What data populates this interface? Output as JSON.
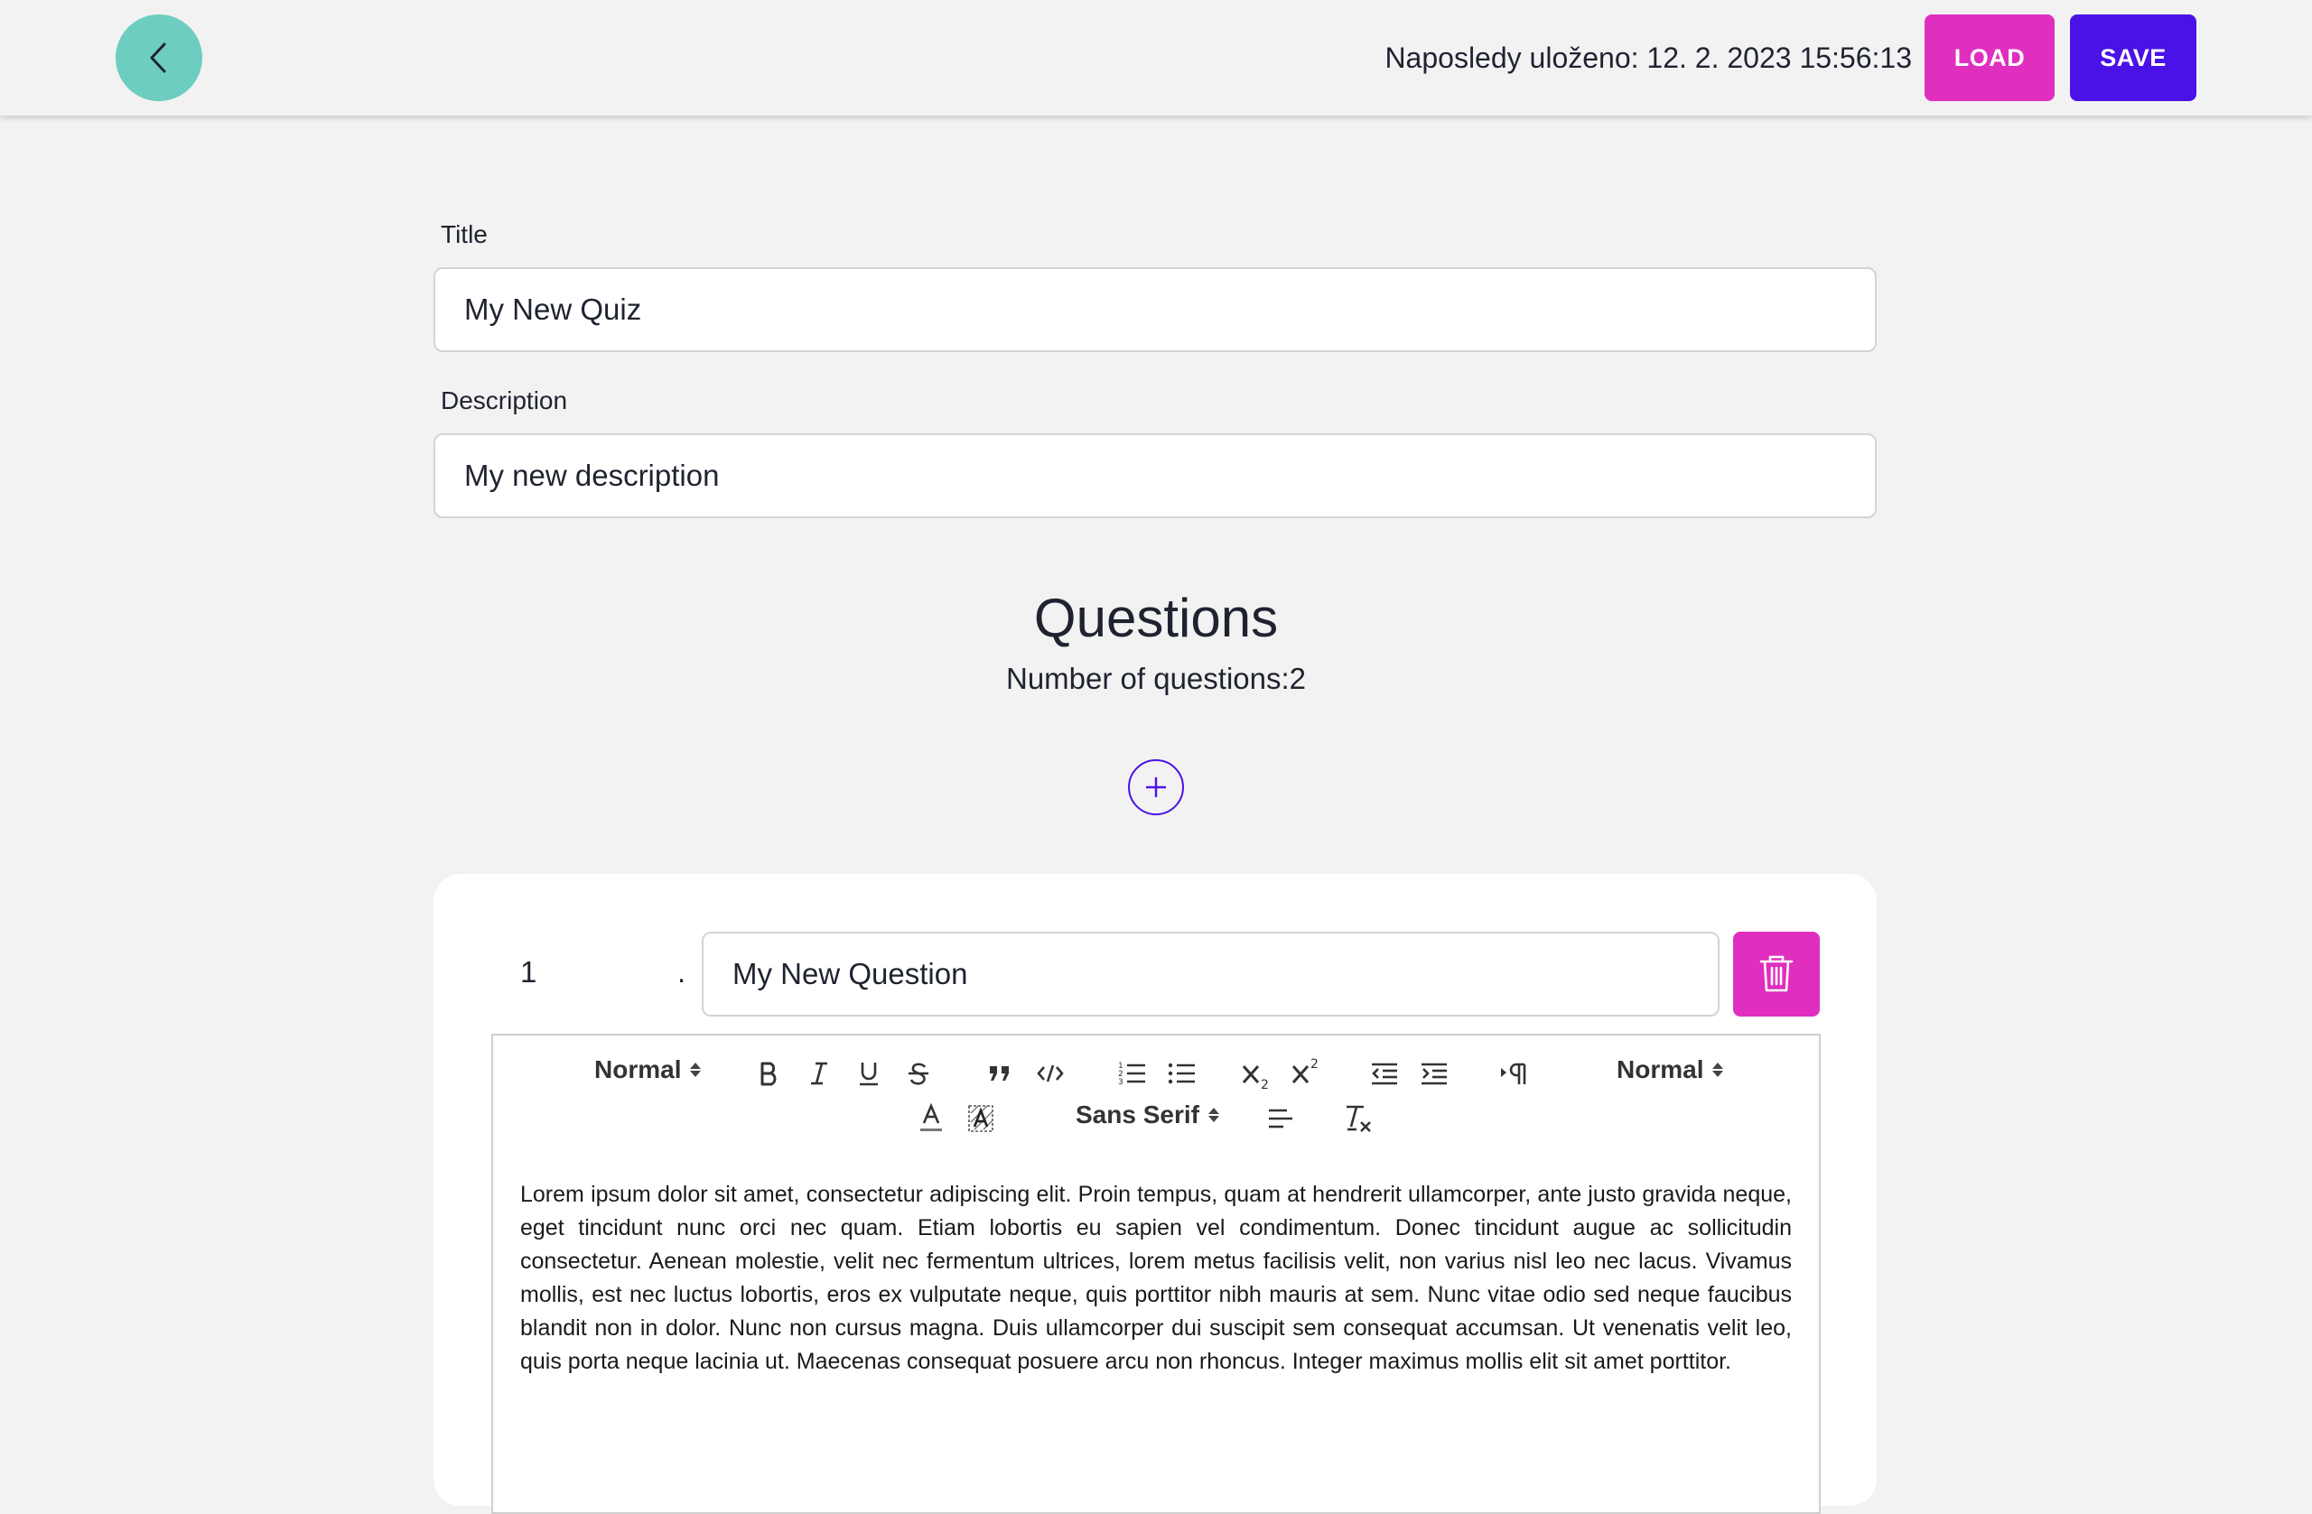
{
  "header": {
    "last_saved_label": "Naposledy uloženo:",
    "last_saved_value": "12. 2. 2023 15:56:13",
    "load_label": "LOAD",
    "save_label": "SAVE"
  },
  "form": {
    "title_label": "Title",
    "title_value": "My New Quiz",
    "description_label": "Description",
    "description_value": "My new description"
  },
  "questions": {
    "heading": "Questions",
    "count_text": "Number of questions:2",
    "items": [
      {
        "number": "1",
        "separator": ".",
        "title": "My New Question",
        "body": "Lorem ipsum dolor sit amet, consectetur adipiscing elit. Proin tempus, quam at hendrerit ullamcorper, ante justo gravida neque, eget tincidunt nunc orci nec quam. Etiam lobortis eu sapien vel condimentum. Donec tincidunt augue ac sollicitudin consectetur. Aenean molestie, velit nec fermentum ultrices, lorem metus facilisis velit, non varius nisl leo nec lacus. Vivamus mollis, est nec luctus lobortis, eros ex vulputate neque, quis porttitor nibh mauris at sem. Nunc vitae odio sed neque faucibus blandit non in dolor. Nunc non cursus magna. Duis ullamcorper dui suscipit sem consequat accumsan. Ut venenatis velit leo, quis porta neque lacinia ut. Maecenas consequat posuere arcu non rhoncus. Integer maximus mollis elit sit amet porttitor."
      }
    ]
  },
  "toolbar": {
    "header_picker": "Normal",
    "size_picker": "Normal",
    "font_picker": "Sans Serif",
    "icons": [
      "bold-icon",
      "italic-icon",
      "underline-icon",
      "strike-icon",
      "blockquote-icon",
      "code-block-icon",
      "ordered-list-icon",
      "bullet-list-icon",
      "subscript-icon",
      "superscript-icon",
      "outdent-icon",
      "indent-icon",
      "rtl-direction-icon",
      "font-color-icon",
      "background-color-icon",
      "align-left-icon",
      "clean-format-icon"
    ]
  },
  "colors": {
    "background": "#f2f2f2",
    "back_button": "#6ccdc0",
    "load_button": "#e02fbf",
    "save_button": "#4b12e8",
    "delete_button": "#e02fbf",
    "add_button_outline": "#4b12e8"
  }
}
